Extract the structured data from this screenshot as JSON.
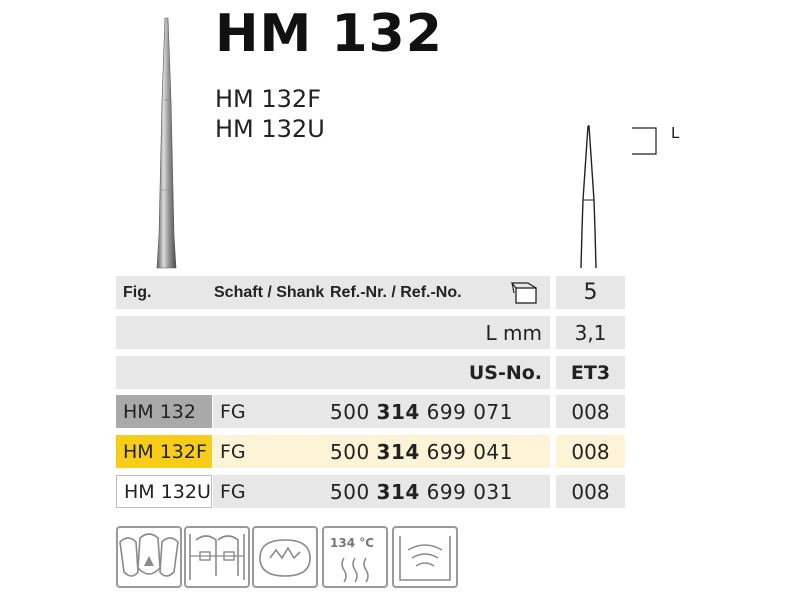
{
  "product": {
    "title": "HM 132",
    "variants": [
      "HM 132F",
      "HM 132U"
    ]
  },
  "dimension_label": "L",
  "table": {
    "header": {
      "fig": "Fig.",
      "shank": "Schaft / Shank",
      "ref": "Ref.-Nr. / Ref.-No.",
      "pack_icon": "package-icon",
      "pack_qty": "5"
    },
    "length_label": "L mm",
    "length_value": "3,1",
    "us_label": "US-No.",
    "us_value": "ET3",
    "rows": [
      {
        "fig": "HM 132",
        "shank": "FG",
        "ref_prefix": "500",
        "ref_bold": "314",
        "ref_suffix": "699 071",
        "iso": "008",
        "color": "#a9a9a9"
      },
      {
        "fig": "HM 132F",
        "shank": "FG",
        "ref_prefix": "500",
        "ref_bold": "314",
        "ref_suffix": "699 041",
        "iso": "008",
        "color": "#f7cd1a"
      },
      {
        "fig": "HM 132U",
        "shank": "FG",
        "ref_prefix": "500",
        "ref_bold": "314",
        "ref_suffix": "699 031",
        "iso": "008",
        "color": "#ffffff"
      }
    ]
  },
  "icons": {
    "items": [
      "anterior-teeth-icon",
      "crown-prep-icon",
      "cavity-icon",
      "sterilization-icon",
      "ultrasonic-cleaning-icon"
    ],
    "sterilization_temp": "134 °C"
  }
}
